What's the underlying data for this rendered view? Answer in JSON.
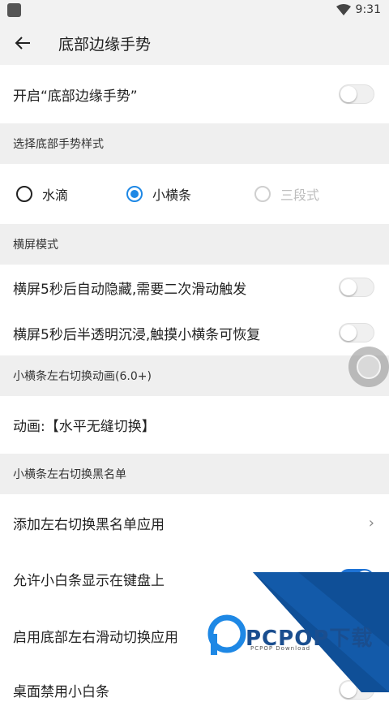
{
  "status_bar": {
    "time": "9:31"
  },
  "app_bar": {
    "title": "底部边缘手势"
  },
  "main_toggle": {
    "label": "开启“底部边缘手势”",
    "on": false
  },
  "style_section": {
    "header": "选择底部手势样式",
    "options": [
      {
        "label": "水滴",
        "selected": false,
        "enabled": true
      },
      {
        "label": "小横条",
        "selected": true,
        "enabled": true
      },
      {
        "label": "三段式",
        "selected": false,
        "enabled": false
      }
    ]
  },
  "landscape_section": {
    "header": "横屏模式",
    "items": [
      {
        "label": "横屏5秒后自动隐藏,需要二次滑动触发",
        "on": false
      },
      {
        "label": "横屏5秒后半透明沉浸,触摸小横条可恢复",
        "on": false
      }
    ]
  },
  "animation_section": {
    "header": "小横条左右切换动画(6.0+)",
    "item": "动画:【水平无缝切换】"
  },
  "blacklist_section": {
    "header": "小横条左右切换黑名单",
    "items": [
      {
        "label": "添加左右切换黑名单应用",
        "type": "nav"
      },
      {
        "label": "允许小白条显示在键盘上",
        "on": true
      },
      {
        "label": "启用底部左右滑动切换应用",
        "on": false
      },
      {
        "label": "桌面禁用小白条",
        "on": false
      }
    ]
  },
  "watermark": {
    "brand": "PCPOP下载",
    "sub": "PCPOP Download"
  },
  "colors": {
    "accent": "#1e73d6",
    "radio": "#1e88e5",
    "section_bg": "#efefef"
  }
}
